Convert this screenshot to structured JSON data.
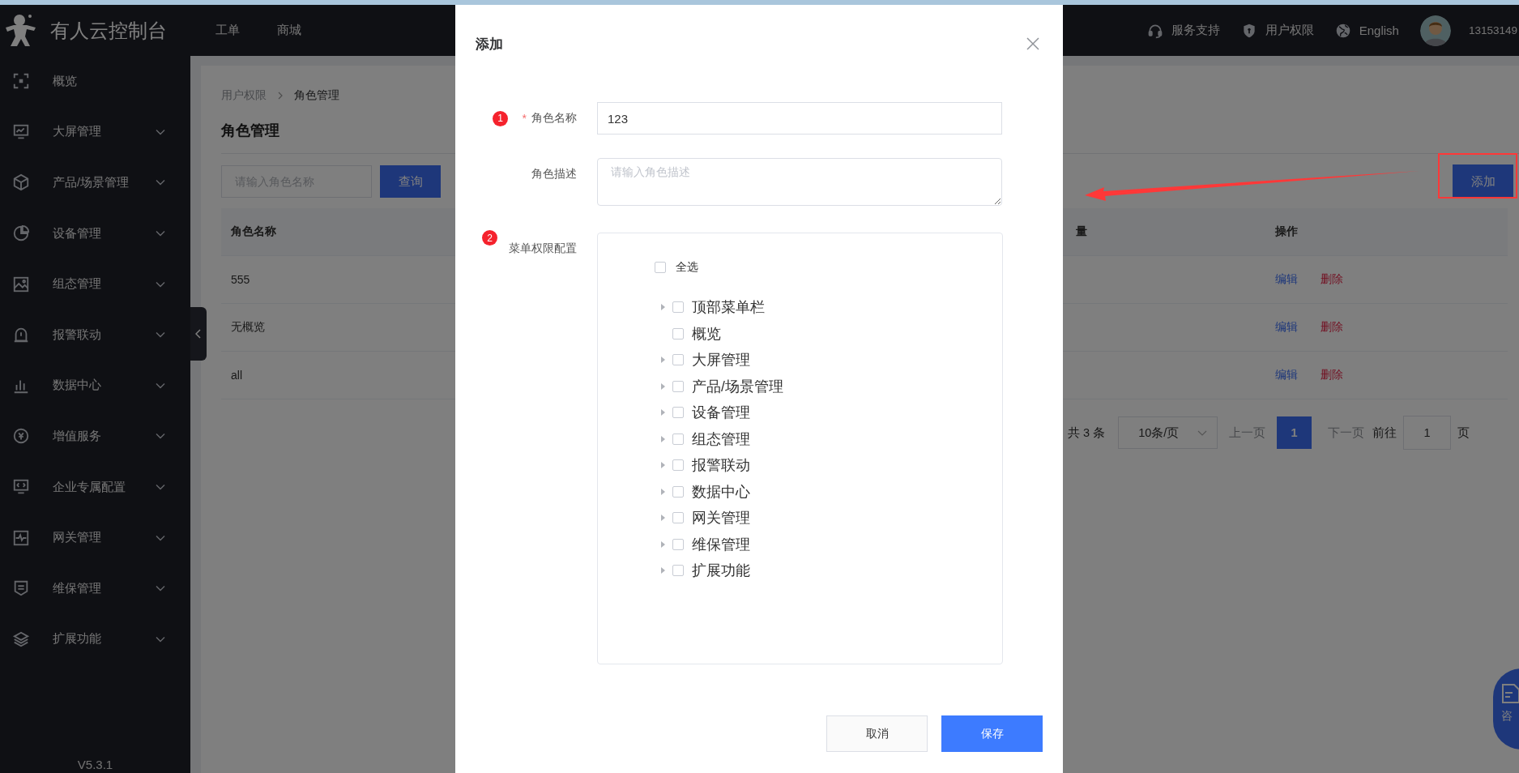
{
  "header": {
    "logo_text": "有人云控制台",
    "nav": [
      "工单",
      "商城"
    ],
    "links": [
      {
        "kind": "support",
        "label": "服务支持"
      },
      {
        "kind": "permission",
        "label": "用户权限"
      },
      {
        "kind": "language",
        "label": "English"
      }
    ],
    "account": "13153149"
  },
  "sidebar": {
    "items": [
      {
        "kind": "overview",
        "label": "概览",
        "expandable": false
      },
      {
        "kind": "screen",
        "label": "大屏管理",
        "expandable": true
      },
      {
        "kind": "cube",
        "label": "产品/场景管理",
        "expandable": true
      },
      {
        "kind": "pie",
        "label": "设备管理",
        "expandable": true
      },
      {
        "kind": "image",
        "label": "组态管理",
        "expandable": true
      },
      {
        "kind": "alarm",
        "label": "报警联动",
        "expandable": true
      },
      {
        "kind": "bars",
        "label": "数据中心",
        "expandable": true
      },
      {
        "kind": "coin",
        "label": "增值服务",
        "expandable": true
      },
      {
        "kind": "code",
        "label": "企业专属配置",
        "expandable": true
      },
      {
        "kind": "pulse",
        "label": "网关管理",
        "expandable": true
      },
      {
        "kind": "shield",
        "label": "维保管理",
        "expandable": true
      },
      {
        "kind": "layers",
        "label": "扩展功能",
        "expandable": true
      }
    ],
    "version": "V5.3.1"
  },
  "breadcrumb": [
    "用户权限",
    "角色管理"
  ],
  "page_title": "角色管理",
  "search": {
    "placeholder": "请输入角色名称"
  },
  "query_button": "查询",
  "add_button": "添加",
  "table": {
    "columns": [
      "角色名称",
      "量",
      "操作"
    ],
    "rows": [
      {
        "name": "555",
        "actions": [
          {
            "kind": "edit",
            "label": "编辑"
          },
          {
            "kind": "danger",
            "label": "删除"
          }
        ]
      },
      {
        "name": "无概览",
        "actions": [
          {
            "kind": "edit",
            "label": "编辑"
          },
          {
            "kind": "danger",
            "label": "删除"
          }
        ]
      },
      {
        "name": "all",
        "actions": [
          {
            "kind": "edit",
            "label": "编辑"
          },
          {
            "kind": "danger",
            "label": "删除"
          }
        ]
      }
    ]
  },
  "pagination": {
    "total": "共 3 条",
    "page_size": "10条/页",
    "prev": "上一页",
    "pages": [
      {
        "label": "1",
        "selected": true
      }
    ],
    "next": "下一页",
    "goto_label": "前往",
    "goto_value": "1",
    "suffix": "页"
  },
  "consult_button": "咨",
  "dialog": {
    "title": "添加",
    "fields": [
      {
        "marker": "1",
        "required_mark": "*",
        "label": "角色名称",
        "value": "123"
      },
      {
        "label": "角色描述",
        "placeholder": "请输入角色描述"
      }
    ],
    "menu_permissions": {
      "marker": "2",
      "label": "菜单权限配置",
      "select_all": {
        "label": "全选",
        "checked": false
      },
      "tree": [
        {
          "kind": "branch",
          "label": "顶部菜单栏",
          "checked": false
        },
        {
          "kind": "leaf",
          "label": "概览",
          "checked": false
        },
        {
          "kind": "branch",
          "label": "大屏管理",
          "checked": false
        },
        {
          "kind": "branch",
          "label": "产品/场景管理",
          "checked": false
        },
        {
          "kind": "branch",
          "label": "设备管理",
          "checked": false
        },
        {
          "kind": "branch",
          "label": "组态管理",
          "checked": false
        },
        {
          "kind": "branch",
          "label": "报警联动",
          "checked": false
        },
        {
          "kind": "branch",
          "label": "数据中心",
          "checked": false
        },
        {
          "kind": "branch",
          "label": "网关管理",
          "checked": false
        },
        {
          "kind": "branch",
          "label": "维保管理",
          "checked": false
        },
        {
          "kind": "branch",
          "label": "扩展功能",
          "checked": false
        }
      ]
    },
    "buttons": [
      {
        "kind": "default",
        "label": "取消"
      },
      {
        "kind": "primary",
        "label": "保存"
      }
    ]
  }
}
